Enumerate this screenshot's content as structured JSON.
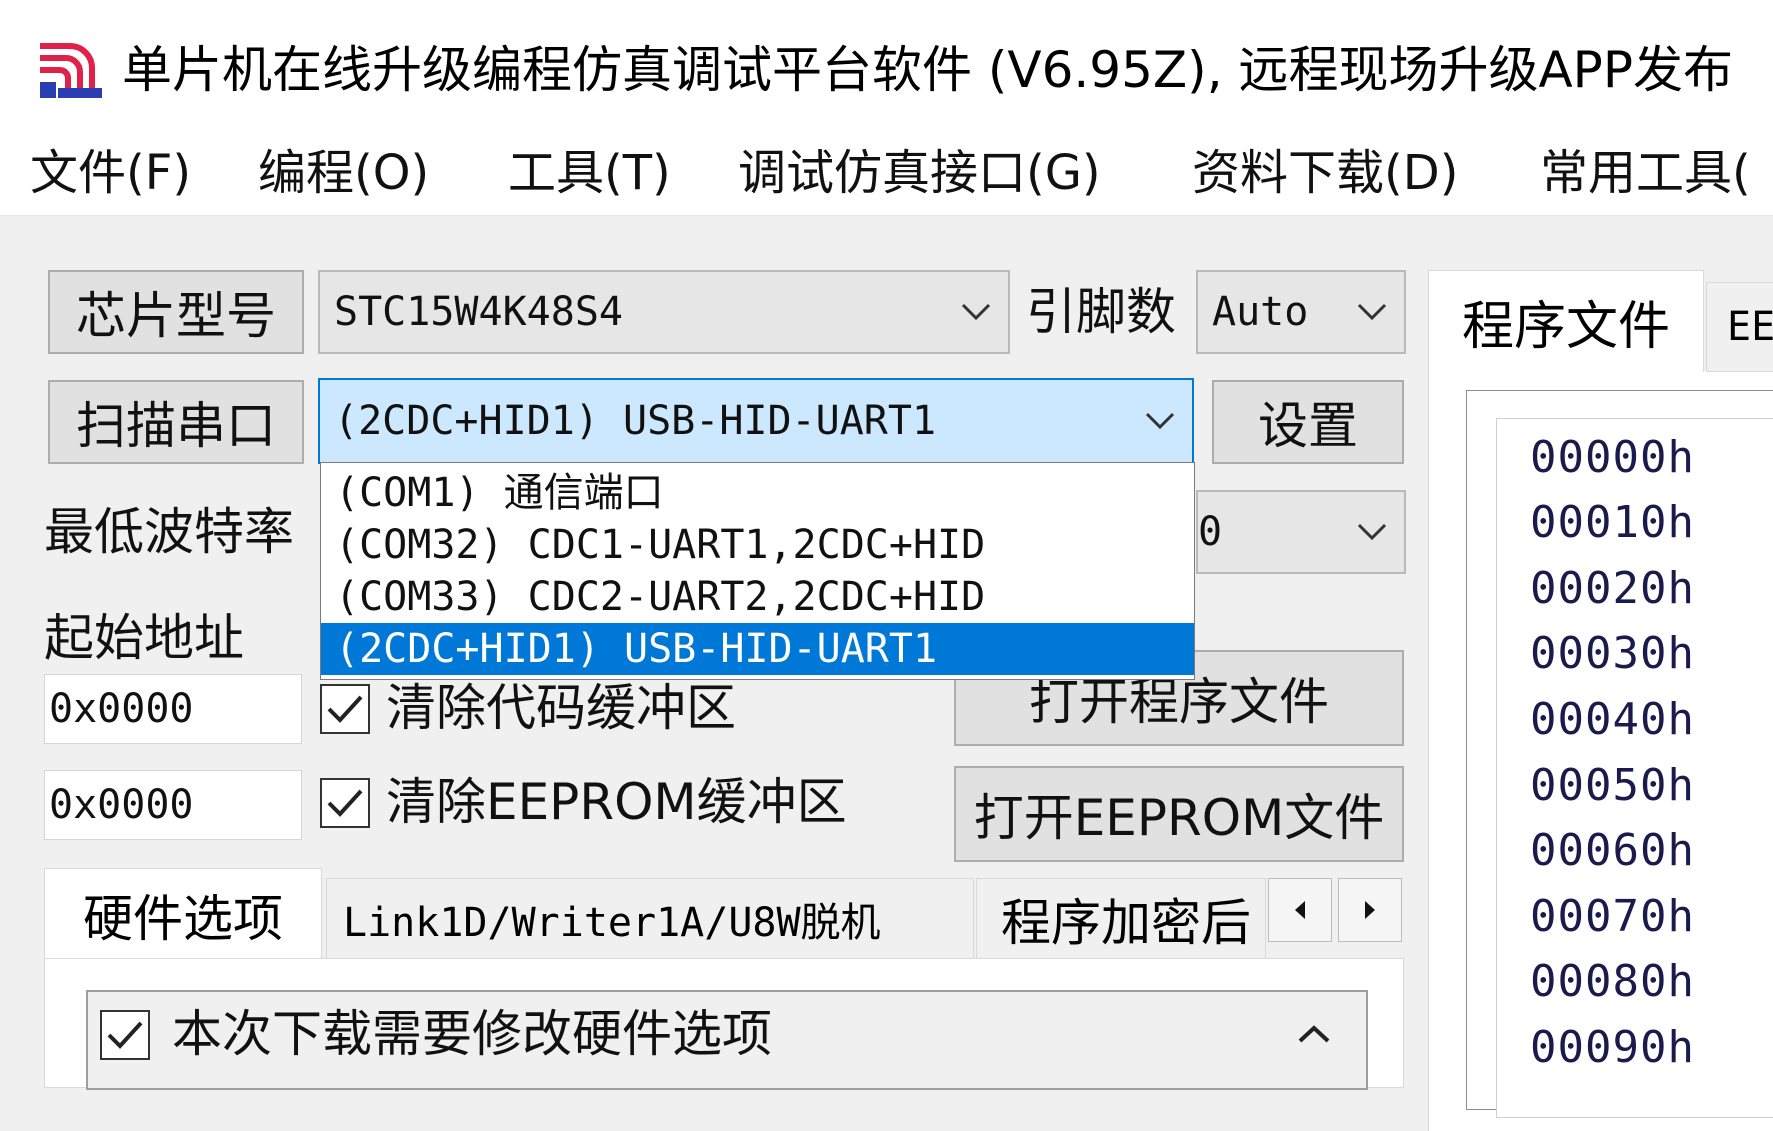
{
  "window": {
    "title": "单片机在线升级编程仿真调试平台软件 (V6.95Z), 远程现场升级APP发布"
  },
  "menu": [
    {
      "label": "文件(F)"
    },
    {
      "label": "编程(O)"
    },
    {
      "label": "工具(T)"
    },
    {
      "label": "调试仿真接口(G)"
    },
    {
      "label": "资料下载(D)"
    },
    {
      "label": "常用工具("
    }
  ],
  "chip": {
    "button_label": "芯片型号",
    "selected": "STC15W4K48S4",
    "pins_label": "引脚数",
    "pins_value": "Auto"
  },
  "port": {
    "scan_button_label": "扫描串口",
    "selected": "(2CDC+HID1) USB-HID-UART1",
    "settings_button_label": "设置",
    "options": [
      "(COM1) 通信端口",
      "(COM32) CDC1-UART1,2CDC+HID",
      "(COM33) CDC2-UART2,2CDC+HID",
      "(2CDC+HID1) USB-HID-UART1"
    ],
    "selected_index": 3
  },
  "baud": {
    "label": "最低波特率",
    "hidden_value_tail": "0"
  },
  "start_address": {
    "label": "起始地址",
    "code_value": "0x0000",
    "eeprom_value": "0x0000"
  },
  "checkboxes": {
    "clear_code": {
      "label": "清除代码缓冲区",
      "checked": true
    },
    "clear_eeprom": {
      "label": "清除EEPROM缓冲区",
      "checked": true
    }
  },
  "buttons": {
    "open_program": "打开程序文件",
    "open_eeprom": "打开EEPROM文件"
  },
  "bottom_tabs": [
    {
      "label": "硬件选项",
      "active": true
    },
    {
      "label": "Link1D/Writer1A/U8W脱机",
      "active": false
    },
    {
      "label": "程序加密后",
      "active": false
    }
  ],
  "hardware": {
    "modify_option_label": "本次下载需要修改硬件选项",
    "modify_option_checked": true
  },
  "right_panel": {
    "tabs": [
      "程序文件",
      "EE"
    ],
    "addresses": [
      "00000h",
      "00010h",
      "00020h",
      "00030h",
      "00040h",
      "00050h",
      "00060h",
      "00070h",
      "00080h",
      "00090h"
    ]
  },
  "colors": {
    "accent": "#0078d7",
    "selected_combo_bg": "#cce8ff",
    "selected_combo_border": "#0078d7"
  }
}
